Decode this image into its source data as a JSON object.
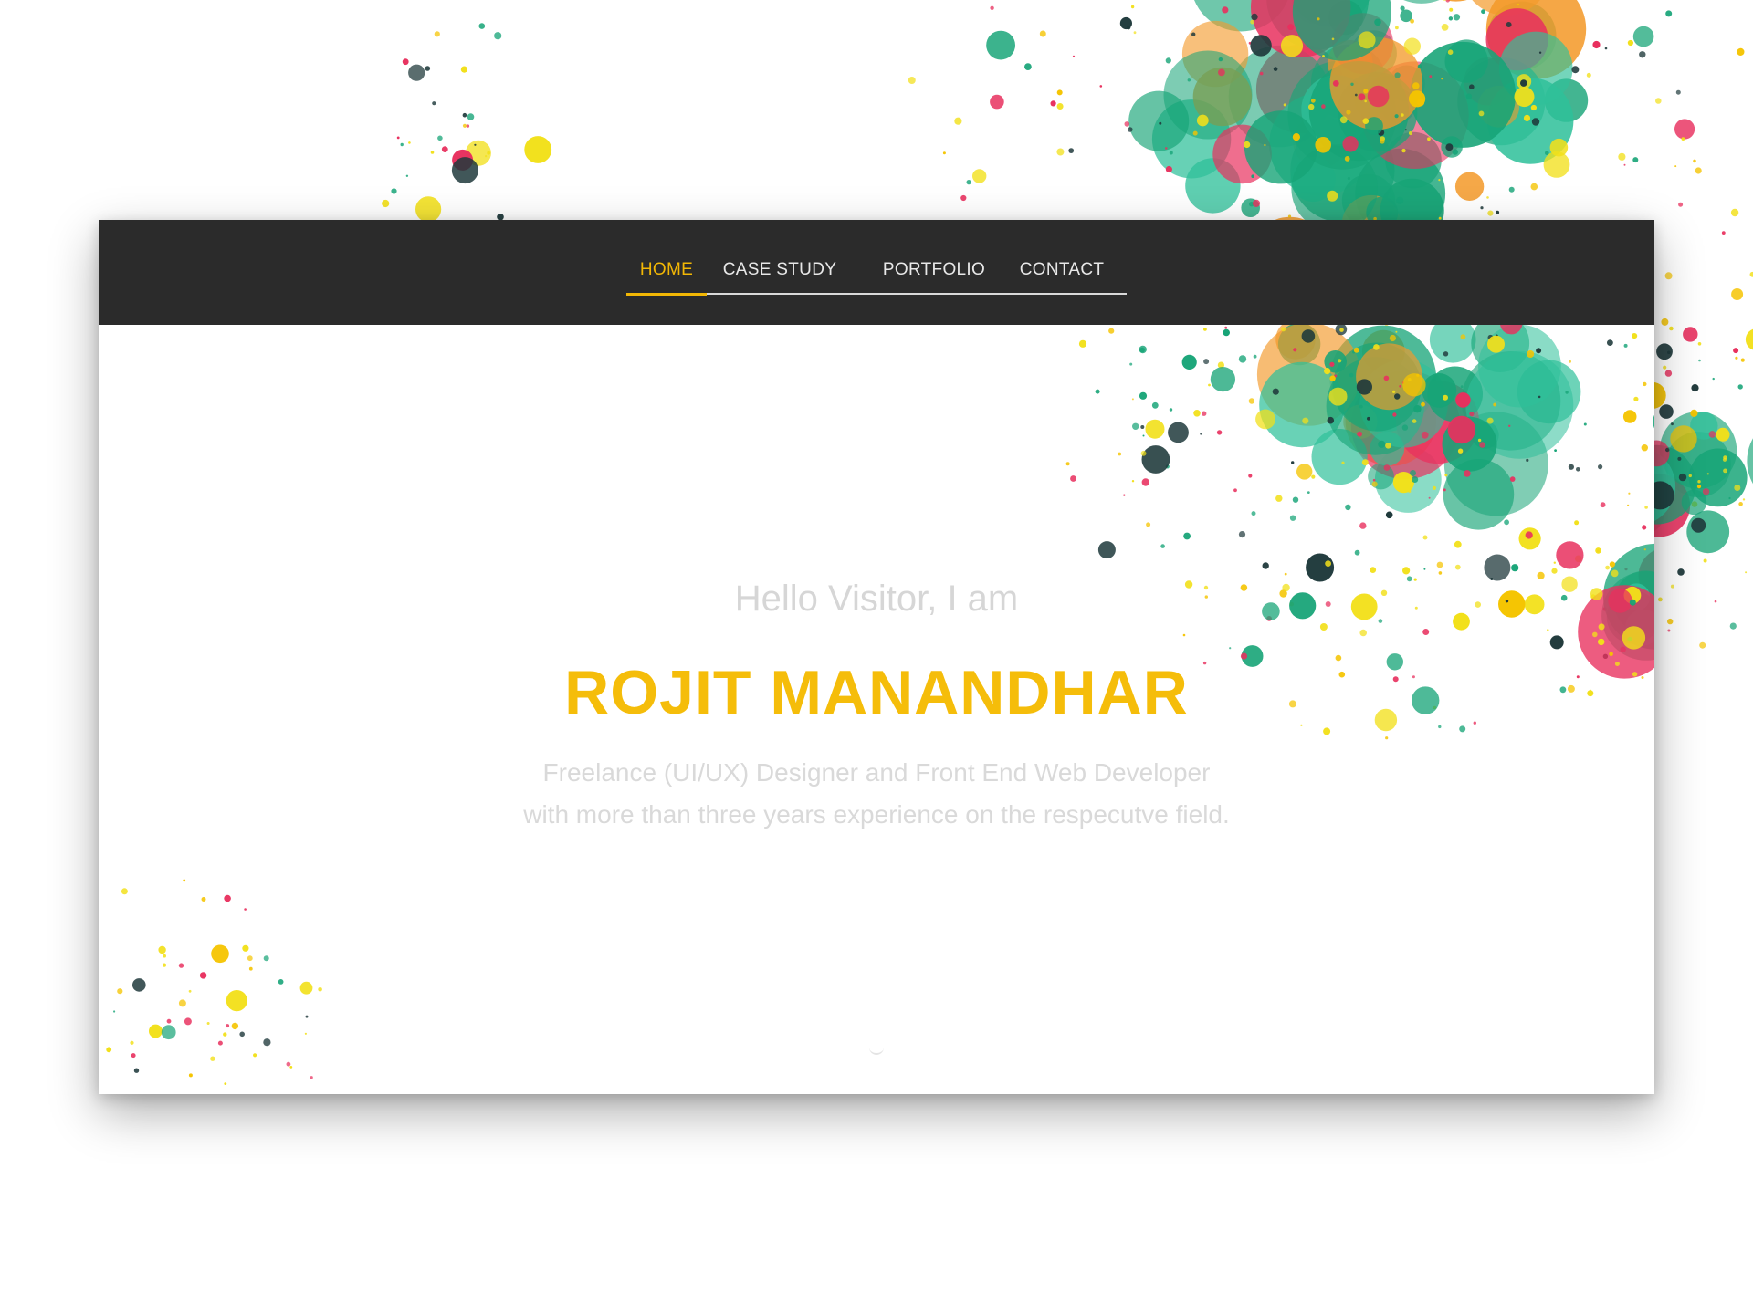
{
  "nav": {
    "items": [
      {
        "label": "HOME",
        "active": true
      },
      {
        "label": "CASE STUDY",
        "active": false
      },
      {
        "label": "PORTFOLIO",
        "active": false
      },
      {
        "label": "CONTACT",
        "active": false
      }
    ],
    "background_color": "#2b2b2b",
    "active_color": "#f2b705"
  },
  "hero": {
    "greeting": "Hello Visitor, I am",
    "name": "ROJIT MANANDHAR",
    "description_line1": "Freelance (UI/UX) Designer and Front End Web Developer",
    "description_line2": "with more than three years experience on the respecutve field."
  },
  "colors": {
    "accent": "#f5bd0a",
    "splatter_green": "#17a477",
    "splatter_pink": "#e8305e",
    "splatter_yellow": "#f2e01a",
    "splatter_dark": "#203a3c"
  }
}
